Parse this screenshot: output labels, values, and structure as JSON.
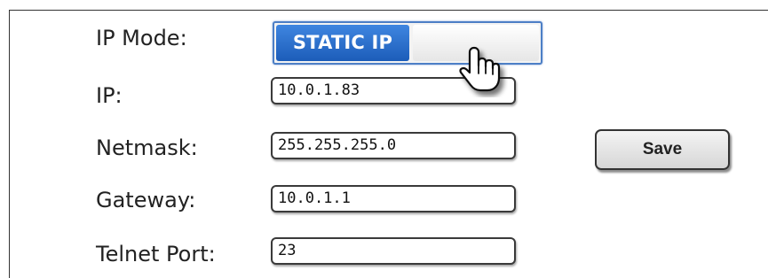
{
  "form": {
    "ip_mode_label": "IP Mode:",
    "ip_mode_value": "STATIC IP",
    "ip_label": "IP:",
    "ip_value": "10.0.1.83",
    "netmask_label": "Netmask:",
    "netmask_value": "255.255.255.0",
    "gateway_label": "Gateway:",
    "gateway_value": "10.0.1.1",
    "telnet_port_label": "Telnet Port:",
    "telnet_port_value": "23",
    "save_label": "Save"
  },
  "colors": {
    "toggle_active": "#2a6fce",
    "toggle_border": "#4d7fc6",
    "field_border": "#3a3a3a"
  },
  "icons": {
    "pointer": "hand-pointer-icon"
  }
}
